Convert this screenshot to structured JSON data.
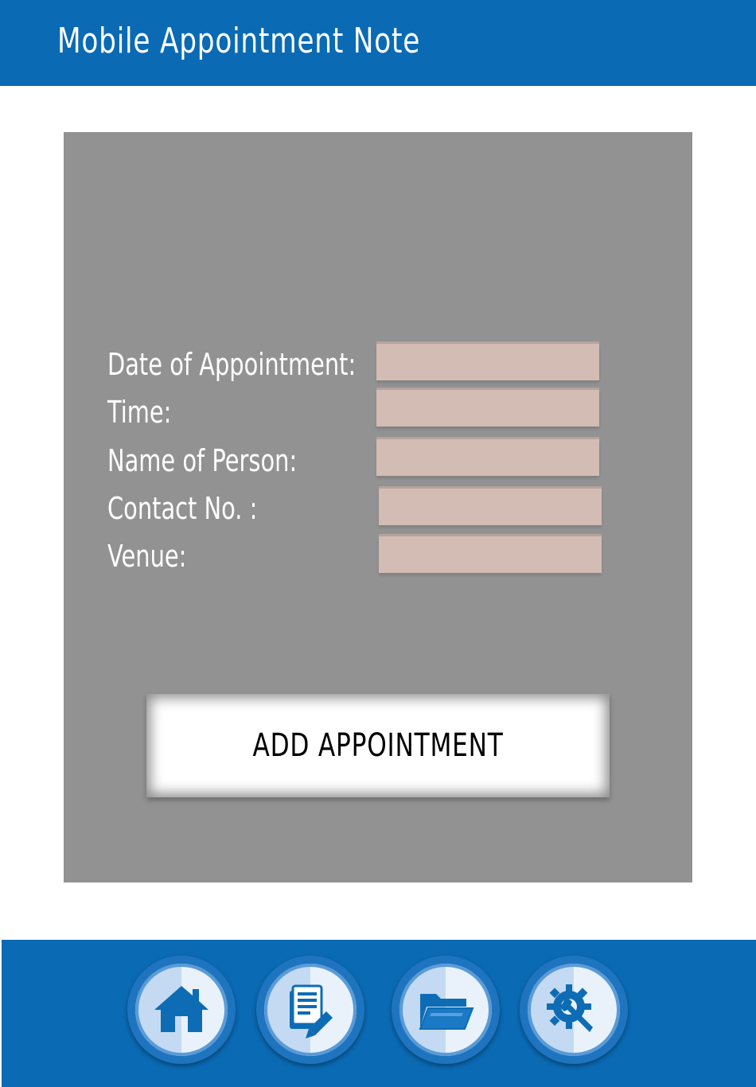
{
  "header": {
    "title": "Mobile Appointment Note"
  },
  "form": {
    "fields": [
      {
        "label": "Date of Appointment:",
        "value": ""
      },
      {
        "label": "Time:",
        "value": ""
      },
      {
        "label": "Name of Person:",
        "value": ""
      },
      {
        "label": "Contact No. :",
        "value": ""
      },
      {
        "label": "Venue:",
        "value": ""
      }
    ],
    "submit_label": "ADD APPOINTMENT"
  },
  "nav": {
    "items": [
      {
        "icon": "home-icon"
      },
      {
        "icon": "notes-icon"
      },
      {
        "icon": "folder-icon"
      },
      {
        "icon": "settings-icon"
      }
    ]
  },
  "colors": {
    "primary": "#0a6ab4",
    "panel": "#929292",
    "field": "#d3bcb3",
    "button": "#ffffff"
  }
}
